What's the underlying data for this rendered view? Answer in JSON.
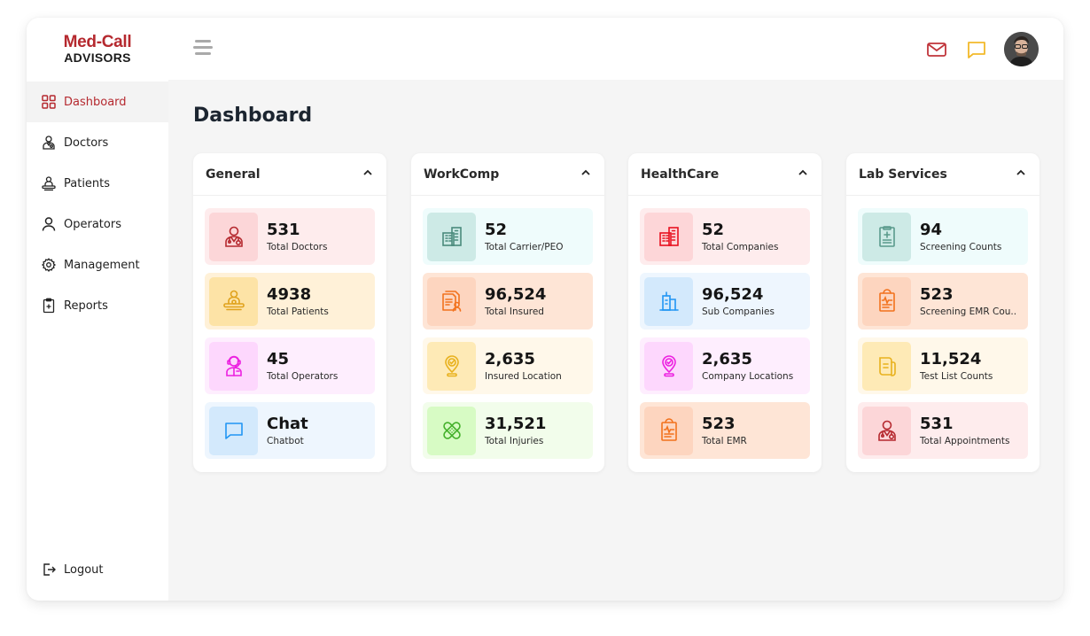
{
  "brand": {
    "line1": "Med-Call",
    "line2": "ADVISORS",
    "color": "#b5292f"
  },
  "sidebar": {
    "items": [
      {
        "label": "Dashboard",
        "icon": "grid-icon",
        "active": true
      },
      {
        "label": "Doctors",
        "icon": "doctor-icon"
      },
      {
        "label": "Patients",
        "icon": "patient-icon"
      },
      {
        "label": "Operators",
        "icon": "user-icon"
      },
      {
        "label": "Management",
        "icon": "gear-icon"
      },
      {
        "label": "Reports",
        "icon": "clipboard-plus-icon"
      }
    ],
    "logout": {
      "label": "Logout",
      "icon": "logout-icon"
    }
  },
  "topbar": {
    "menu_icon": "hamburger-icon",
    "mail_icon": "mail-icon",
    "chat_icon": "chat-icon",
    "avatar": "user-avatar",
    "mail_color": "#c0343a",
    "chat_color": "#f2b92a"
  },
  "page": {
    "title": "Dashboard"
  },
  "panels": [
    {
      "title": "General",
      "stats": [
        {
          "value": "531",
          "label": "Total Doctors",
          "icon": "doctor-icon",
          "bg": "#feeced",
          "icon_bg": "#fcd6d8",
          "color": "#b5292f"
        },
        {
          "value": "4938",
          "label": "Total Patients",
          "icon": "patient-icon",
          "bg": "#fff1d8",
          "icon_bg": "#fde3a6",
          "color": "#e0a21c"
        },
        {
          "value": "45",
          "label": "Total Operators",
          "icon": "operator-icon",
          "bg": "#feeefe",
          "icon_bg": "#fdd7fd",
          "color": "#ec20e0"
        },
        {
          "value": "Chat",
          "label": "Chatbot",
          "icon": "chat-icon",
          "bg": "#eef6fe",
          "icon_bg": "#d3e9fc",
          "color": "#2196f3"
        }
      ]
    },
    {
      "title": "WorkComp",
      "stats": [
        {
          "value": "52",
          "label": "Total Carrier/PEO",
          "icon": "building-icon",
          "bg": "#effcfc",
          "icon_bg": "#cdeae6",
          "color": "#4a8a7c"
        },
        {
          "value": "96,524",
          "label": "Total Insured",
          "icon": "insured-document-icon",
          "bg": "#fee5d6",
          "icon_bg": "#fdd5bf",
          "color": "#f2721d"
        },
        {
          "value": "2,635",
          "label": "Insured Location",
          "icon": "location-check-icon",
          "bg": "#fff8ea",
          "icon_bg": "#feeab6",
          "color": "#e8b11d"
        },
        {
          "value": "31,521",
          "label": "Total Injuries",
          "icon": "bandage-icon",
          "bg": "#f2fdeb",
          "icon_bg": "#d7fbc4",
          "color": "#43b02a"
        }
      ]
    },
    {
      "title": "HealthCare",
      "stats": [
        {
          "value": "52",
          "label": "Total Companies",
          "icon": "building-icon",
          "bg": "#feeced",
          "icon_bg": "#fdd6d8",
          "color": "#e8111f"
        },
        {
          "value": "96,524",
          "label": "Sub Companies",
          "icon": "sub-building-icon",
          "bg": "#eef6fe",
          "icon_bg": "#d3e9fc",
          "color": "#2196f3"
        },
        {
          "value": "2,635",
          "label": "Company Locations",
          "icon": "location-check-icon",
          "bg": "#feeefe",
          "icon_bg": "#fdd7fd",
          "color": "#ec20e0"
        },
        {
          "value": "523",
          "label": "Total EMR",
          "icon": "emr-clipboard-icon",
          "bg": "#fee5d6",
          "icon_bg": "#fdd5bf",
          "color": "#f2721d"
        }
      ]
    },
    {
      "title": "Lab Services",
      "stats": [
        {
          "value": "94",
          "label": "Screening Counts",
          "icon": "clipboard-plus-icon",
          "bg": "#effcfc",
          "icon_bg": "#cdeae6",
          "color": "#5a9a8c"
        },
        {
          "value": "523",
          "label": "Screening EMR Cou..",
          "icon": "emr-clipboard-icon",
          "bg": "#fee5d6",
          "icon_bg": "#fdd5bf",
          "color": "#f2721d"
        },
        {
          "value": "11,524",
          "label": "Test List Counts",
          "icon": "document-list-icon",
          "bg": "#fff8ea",
          "icon_bg": "#feeab6",
          "color": "#e8b11d"
        },
        {
          "value": "531",
          "label": "Total Appointments",
          "icon": "doctor-icon",
          "bg": "#feeced",
          "icon_bg": "#fcd6d8",
          "color": "#b5292f"
        }
      ]
    }
  ]
}
